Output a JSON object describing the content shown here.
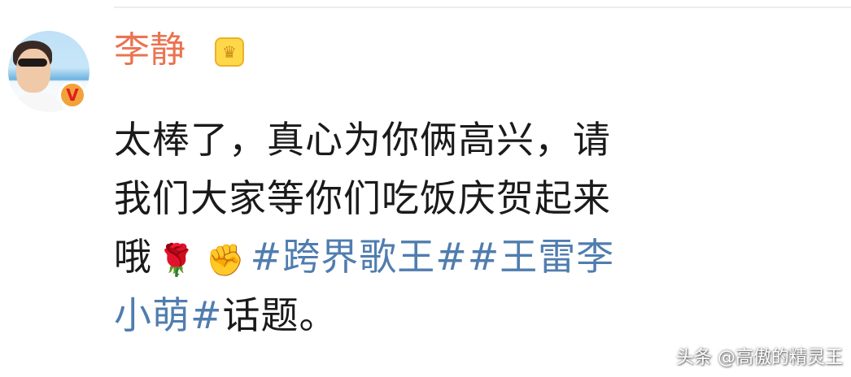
{
  "post": {
    "author": "李静",
    "text_line1": "太棒了，真心为你俩高兴，请",
    "text_line2": "我们大家等你们吃饭庆贺起来",
    "text_line3_prefix": "哦",
    "emoji_rose": "🌹",
    "emoji_fist": "✊",
    "hashtag1": "#跨界歌王#",
    "hashtag2_part1": "#王雷李",
    "hashtag2_part2": "小萌#",
    "text_suffix": "话题。"
  },
  "icons": {
    "verified": "V",
    "crown": "♛"
  },
  "watermark": "头条 @高傲的精灵王",
  "colors": {
    "username": "#eb7350",
    "hashtag": "#507daf",
    "verified_badge": "#f2a23a"
  }
}
